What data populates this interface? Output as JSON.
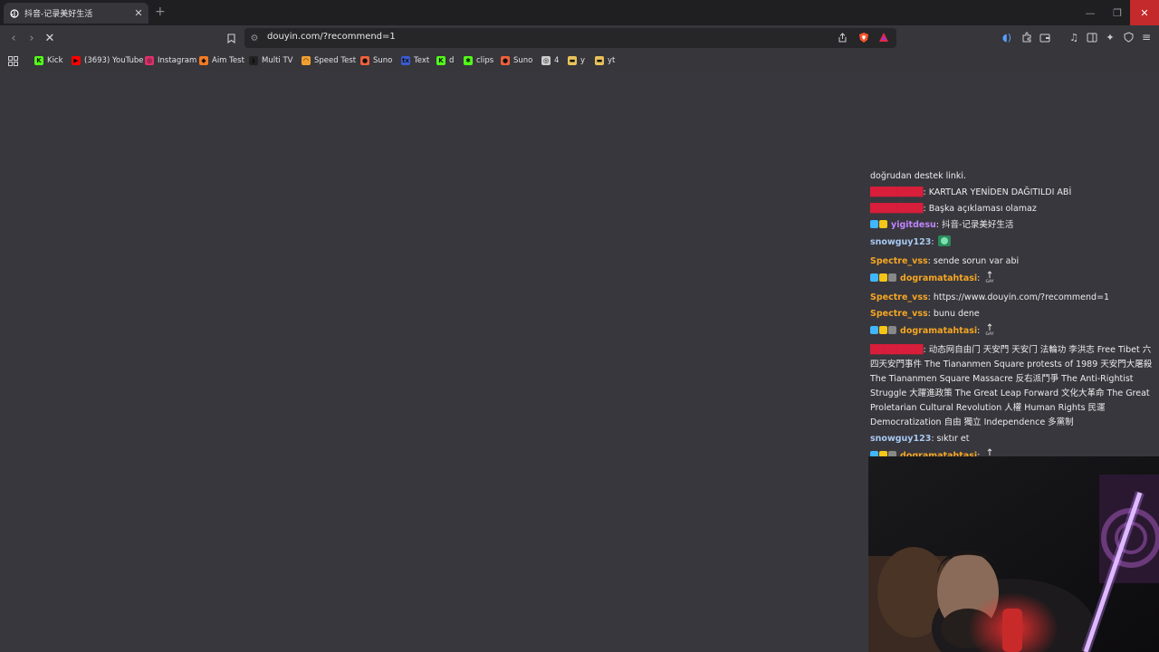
{
  "tab": {
    "title": "抖音-记录美好生活"
  },
  "address_bar": {
    "url": "douyin.com/?recommend=1"
  },
  "bookmarks": [
    {
      "label": "Kick",
      "color": "#53fc18",
      "glyph": "K"
    },
    {
      "label": "(3693) YouTube",
      "color": "#ff0000",
      "glyph": "▶"
    },
    {
      "label": "Instagram",
      "color": "#e1306c",
      "glyph": "◎"
    },
    {
      "label": "Aim Test",
      "color": "#f27a24",
      "glyph": "◆"
    },
    {
      "label": "Multi TV",
      "color": "#222222",
      "glyph": "▮"
    },
    {
      "label": "Speed Test",
      "color": "#f0a030",
      "glyph": "◠"
    },
    {
      "label": "Suno",
      "color": "#f0603a",
      "glyph": "●"
    },
    {
      "label": "Text",
      "color": "#3a5bd0",
      "glyph": "tx"
    },
    {
      "label": "d",
      "color": "#53fc18",
      "glyph": "K"
    },
    {
      "label": "clips",
      "color": "#53fc18",
      "glyph": "✱"
    },
    {
      "label": "Suno",
      "color": "#f0603a",
      "glyph": "●"
    },
    {
      "label": "4",
      "color": "#cccccc",
      "glyph": "◎"
    },
    {
      "label": "y",
      "color": "#e8c25a",
      "glyph": "▬"
    },
    {
      "label": "yt",
      "color": "#e8c25a",
      "glyph": "▬"
    }
  ],
  "colors": {
    "page_bg": "#38373d",
    "username_orange": "#f5a623",
    "username_red": "#d81e3a",
    "username_purple": "#c084fc",
    "username_blue": "#a8c8f0"
  },
  "chat": [
    {
      "user": "",
      "text": "doğrudan destek linki."
    },
    {
      "user": "████████",
      "user_color": "#d81e3a",
      "text": "KARTLAR YENİDEN DAĞITILDI ABİ"
    },
    {
      "user": "████████",
      "user_color": "#d81e3a",
      "text": "Başka açıklaması olamaz"
    },
    {
      "user": "yigitdesu",
      "user_color": "#c084fc",
      "badges": 2,
      "text": "抖音-记录美好生活"
    },
    {
      "user": "snowguy123",
      "user_color": "#a8c8f0",
      "emote": "green-emote",
      "text": ""
    },
    {
      "user": "Spectre_vss",
      "user_color": "#f5a623",
      "text": "sende sorun var abi"
    },
    {
      "user": "dogramatahtasi",
      "user_color": "#f5a623",
      "badges": 3,
      "emote": "gay-emote",
      "text": ""
    },
    {
      "user": "Spectre_vss",
      "user_color": "#f5a623",
      "text": "https://www.douyin.com/?recommend=1"
    },
    {
      "user": "Spectre_vss",
      "user_color": "#f5a623",
      "text": "bunu dene"
    },
    {
      "user": "dogramatahtasi",
      "user_color": "#f5a623",
      "badges": 3,
      "emote": "gay-emote",
      "text": ""
    },
    {
      "user": "████████",
      "user_color": "#d81e3a",
      "wrap": true,
      "text": "动态网自由门 天安門 天安门 法輪功 李洪志 Free Tibet 六四天安門事件 The Tiananmen Square protests of 1989 天安門大屠殺 The Tiananmen Square Massacre 反右派鬥爭 The Anti-Rightist Struggle 大躍進政策 The Great Leap Forward 文化大革命 The Great Proletarian Cultural Revolution 人權 Human Rights 民運 Democratization 自由 獨立 Independence 多黨制"
    },
    {
      "user": "snowguy123",
      "user_color": "#a8c8f0",
      "text": "sıktır et"
    },
    {
      "user": "dogramatahtasi",
      "user_color": "#f5a623",
      "badges": 3,
      "emote": "gay-emote",
      "text": ""
    }
  ]
}
